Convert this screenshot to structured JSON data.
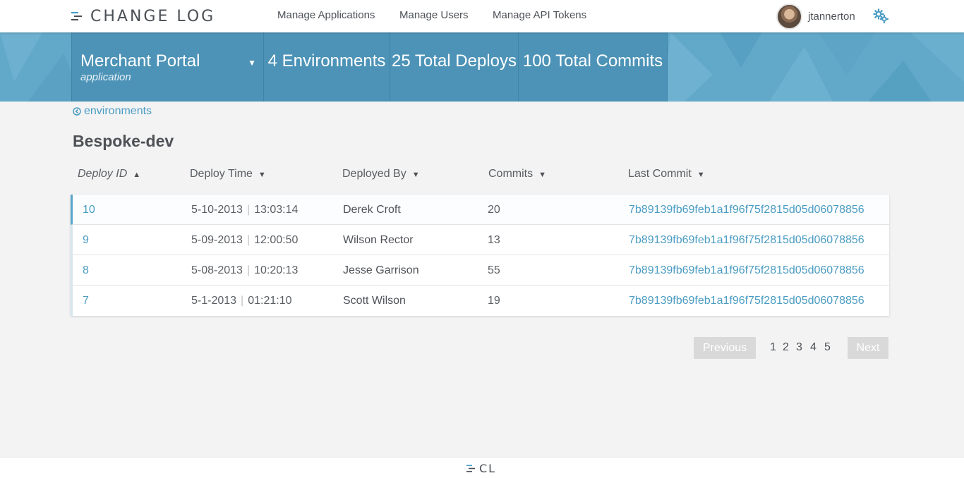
{
  "brand": {
    "name": "CHANGE LOG",
    "footer_mark": "CL"
  },
  "nav": {
    "links": [
      "Manage Applications",
      "Manage Users",
      "Manage API Tokens"
    ],
    "username": "jtannerton"
  },
  "banner": {
    "application": {
      "name": "Merchant Portal",
      "label": "application",
      "caret": "▼"
    },
    "stats": {
      "environments": "4 Environments",
      "deploys": "25 Total Deploys",
      "commits": "100 Total Commits"
    }
  },
  "breadcrumb": {
    "back_label": "environments"
  },
  "environment": {
    "title": "Bespoke-dev"
  },
  "table": {
    "headers": {
      "deploy_id": "Deploy ID",
      "deploy_time": "Deploy Time",
      "deployed_by": "Deployed By",
      "commits": "Commits",
      "last_commit": "Last Commit"
    },
    "sort_arrows": {
      "deploy_id": "▲",
      "deploy_time": "▼",
      "deployed_by": "▼",
      "commits": "▼",
      "last_commit": "▼"
    },
    "rows": [
      {
        "id": "10",
        "date": "5-10-2013",
        "time": "13:03:14",
        "by": "Derek Croft",
        "commits": "20",
        "sha": "7b89139fb69feb1a1f96f75f2815d05d06078856"
      },
      {
        "id": "9",
        "date": "5-09-2013",
        "time": "12:00:50",
        "by": "Wilson Rector",
        "commits": "13",
        "sha": "7b89139fb69feb1a1f96f75f2815d05d06078856"
      },
      {
        "id": "8",
        "date": "5-08-2013",
        "time": "10:20:13",
        "by": "Jesse Garrison",
        "commits": "55",
        "sha": "7b89139fb69feb1a1f96f75f2815d05d06078856"
      },
      {
        "id": "7",
        "date": "5-1-2013",
        "time": "01:21:10",
        "by": "Scott Wilson",
        "commits": "19",
        "sha": "7b89139fb69feb1a1f96f75f2815d05d06078856"
      }
    ]
  },
  "pagination": {
    "previous": "Previous",
    "next": "Next",
    "pages": [
      "1",
      "2",
      "3",
      "4",
      "5"
    ]
  },
  "colors": {
    "accent": "#4b9cc3",
    "banner": "#62a8c9",
    "banner_tile": "#4d93b7",
    "disabled_button": "#d9d9d9"
  },
  "icons": {
    "logo": "change-log-bars-icon",
    "settings": "gears-icon",
    "back": "circle-arrow-left-icon"
  }
}
